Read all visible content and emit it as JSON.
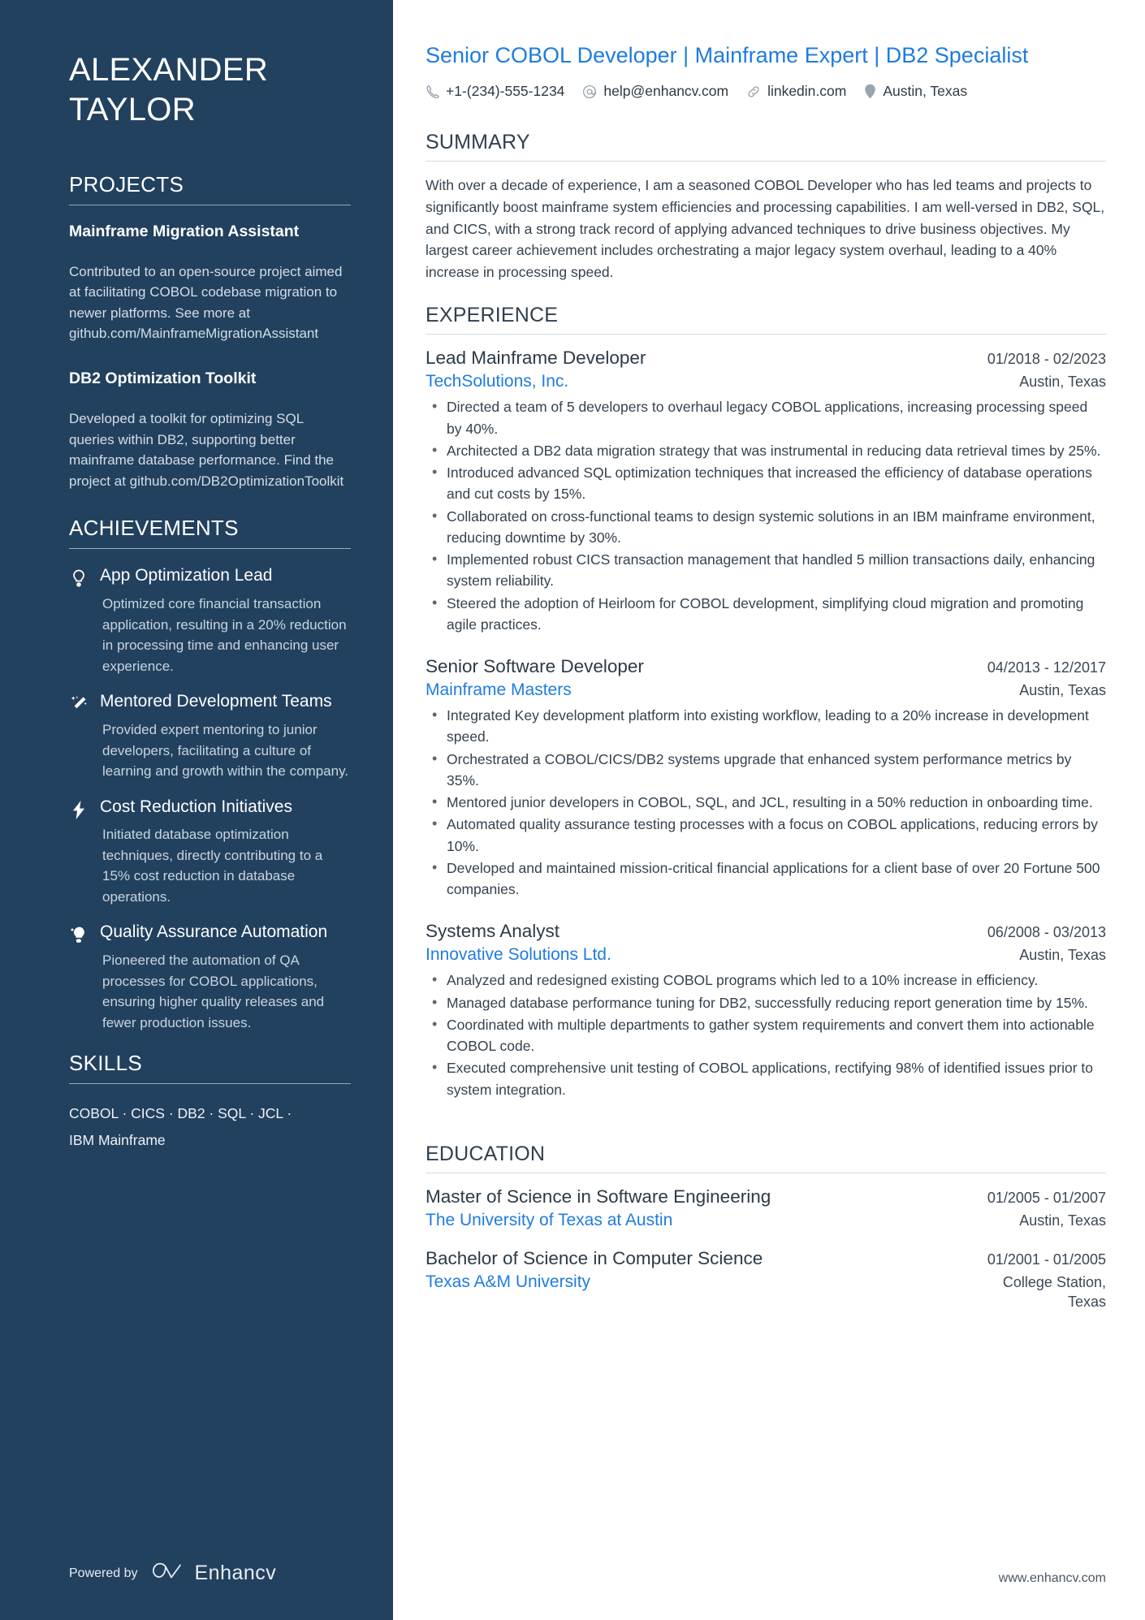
{
  "sidebar": {
    "name": "ALEXANDER\nTAYLOR",
    "projects": {
      "heading": "PROJECTS",
      "items": [
        {
          "title": "Mainframe Migration Assistant",
          "description": "Contributed to an open-source project aimed at facilitating COBOL codebase migration to newer platforms. See more at github.com/MainframeMigrationAssistant"
        },
        {
          "title": "DB2 Optimization Toolkit",
          "description": "Developed a toolkit for optimizing SQL queries within DB2, supporting better mainframe database performance. Find the project at github.com/DB2OptimizationToolkit"
        }
      ]
    },
    "achievements": {
      "heading": "ACHIEVEMENTS",
      "items": [
        {
          "icon": "lightbulb-icon",
          "title": "App Optimization Lead",
          "description": "Optimized core financial transaction application, resulting in a 20% reduction in processing time and enhancing user experience."
        },
        {
          "icon": "magic-wand-icon",
          "title": "Mentored Development Teams",
          "description": "Provided expert mentoring to junior developers, facilitating a culture of learning and growth within the company."
        },
        {
          "icon": "lightning-bolt-icon",
          "title": "Cost Reduction Initiatives",
          "description": "Initiated database optimization techniques, directly contributing to a 15% cost reduction in database operations."
        },
        {
          "icon": "idea-head-icon",
          "title": "Quality Assurance Automation",
          "description": "Pioneered the automation of QA processes for COBOL applications, ensuring higher quality releases and fewer production issues."
        }
      ]
    },
    "skills": {
      "heading": "SKILLS",
      "line1": "COBOL · CICS · DB2 · SQL · JCL ·",
      "line2": "IBM Mainframe"
    },
    "powered": {
      "label": "Powered by",
      "brand": "Enhancv"
    }
  },
  "main": {
    "headline": "Senior COBOL Developer | Mainframe Expert | DB2 Specialist",
    "contacts": [
      {
        "icon": "phone-icon",
        "text": "+1-(234)-555-1234"
      },
      {
        "icon": "at-email-icon",
        "text": "help@enhancv.com"
      },
      {
        "icon": "link-icon",
        "text": "linkedin.com"
      },
      {
        "icon": "map-pin-icon",
        "text": "Austin, Texas"
      }
    ],
    "summary": {
      "heading": "SUMMARY",
      "text": "With over a decade of experience, I am a seasoned COBOL Developer who has led teams and projects to significantly boost mainframe system efficiencies and processing capabilities. I am well-versed in DB2, SQL, and CICS, with a strong track record of applying advanced techniques to drive business objectives. My largest career achievement includes orchestrating a major legacy system overhaul, leading to a 40% increase in processing speed."
    },
    "experience": {
      "heading": "EXPERIENCE",
      "jobs": [
        {
          "title": "Lead Mainframe Developer",
          "dates": "01/2018 - 02/2023",
          "company": "TechSolutions, Inc.",
          "location": "Austin, Texas",
          "bullets": [
            "Directed a team of 5 developers to overhaul legacy COBOL applications, increasing processing speed by 40%.",
            "Architected a DB2 data migration strategy that was instrumental in reducing data retrieval times by 25%.",
            "Introduced advanced SQL optimization techniques that increased the efficiency of database operations and cut costs by 15%.",
            "Collaborated on cross-functional teams to design systemic solutions in an IBM mainframe environment, reducing downtime by 30%.",
            "Implemented robust CICS transaction management that handled 5 million transactions daily, enhancing system reliability.",
            "Steered the adoption of Heirloom for COBOL development, simplifying cloud migration and promoting agile practices."
          ]
        },
        {
          "title": "Senior Software Developer",
          "dates": "04/2013 - 12/2017",
          "company": "Mainframe Masters",
          "location": "Austin, Texas",
          "bullets": [
            "Integrated Key development platform into existing workflow, leading to a 20% increase in development speed.",
            "Orchestrated a COBOL/CICS/DB2 systems upgrade that enhanced system performance metrics by 35%.",
            "Mentored junior developers in COBOL, SQL, and JCL, resulting in a 50% reduction in onboarding time.",
            "Automated quality assurance testing processes with a focus on COBOL applications, reducing errors by 10%.",
            "Developed and maintained mission-critical financial applications for a client base of over 20 Fortune 500 companies."
          ]
        },
        {
          "title": "Systems Analyst",
          "dates": "06/2008 - 03/2013",
          "company": "Innovative Solutions Ltd.",
          "location": "Austin, Texas",
          "bullets": [
            "Analyzed and redesigned existing COBOL programs which led to a 10% increase in efficiency.",
            "Managed database performance tuning for DB2, successfully reducing report generation time by 15%.",
            "Coordinated with multiple departments to gather system requirements and convert them into actionable COBOL code.",
            "Executed comprehensive unit testing of COBOL applications, rectifying 98% of identified issues prior to system integration."
          ]
        }
      ]
    },
    "education": {
      "heading": "EDUCATION",
      "items": [
        {
          "degree": "Master of Science in Software Engineering",
          "dates": "01/2005 - 01/2007",
          "school": "The University of Texas at Austin",
          "location": "Austin, Texas"
        },
        {
          "degree": "Bachelor of Science in Computer Science",
          "dates": "01/2001 - 01/2005",
          "school": "Texas A&M University",
          "location": "College Station, Texas"
        }
      ]
    },
    "footer_url": "www.enhancv.com"
  },
  "colors": {
    "sidebar_bg": "#22415f",
    "accent_blue": "#1f7ce0",
    "body_text": "#35424e"
  }
}
